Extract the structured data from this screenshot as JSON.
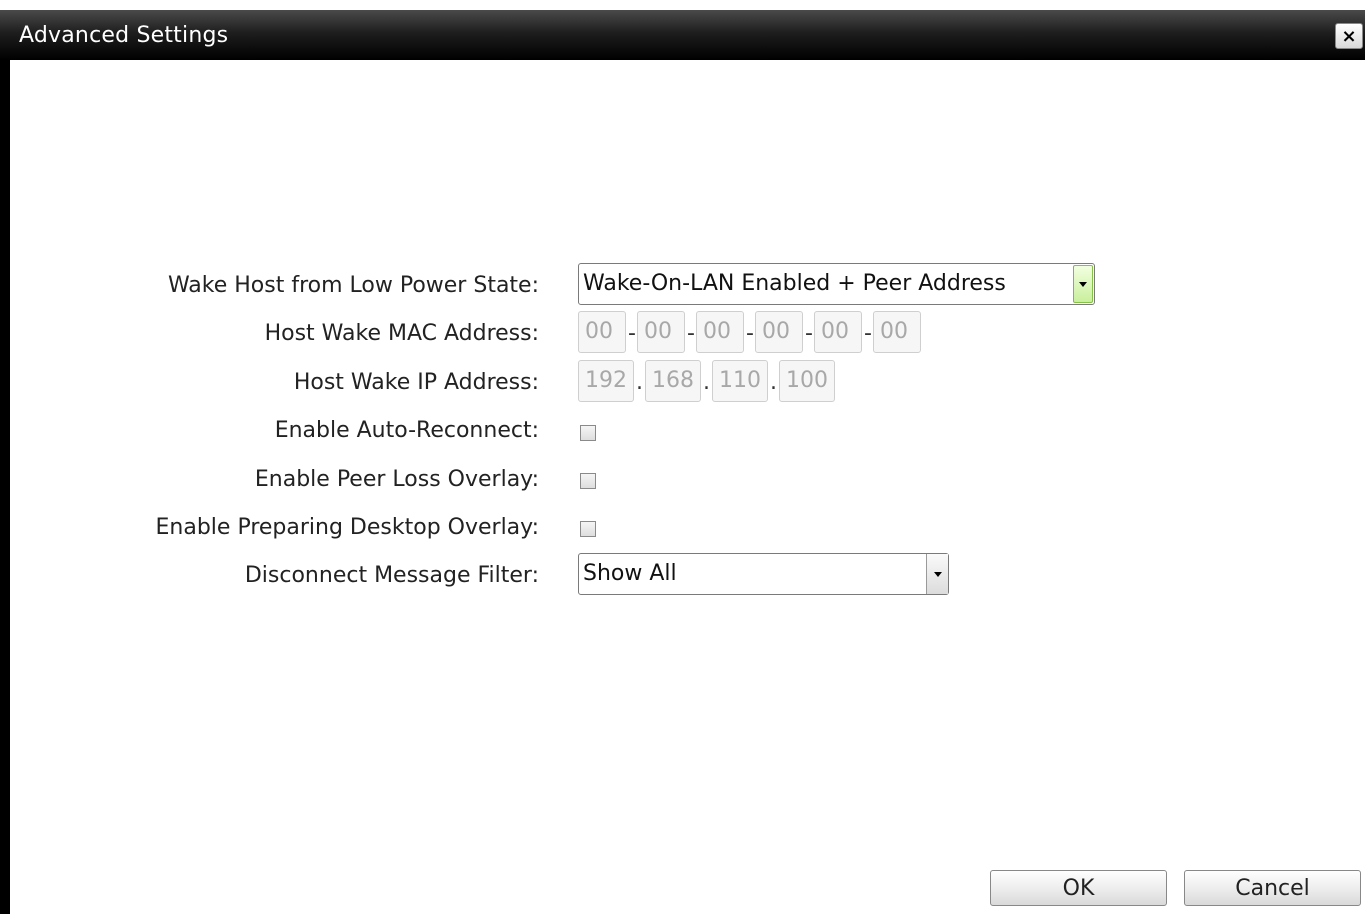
{
  "window": {
    "title": "Advanced Settings",
    "close_glyph": "×"
  },
  "form": {
    "wake_host": {
      "label": "Wake Host from Low Power State:",
      "value": "Wake-On-LAN Enabled + Peer Address"
    },
    "mac": {
      "label": "Host Wake MAC Address:",
      "octets": [
        "00",
        "00",
        "00",
        "00",
        "00",
        "00"
      ],
      "separator": "-"
    },
    "ip": {
      "label": "Host Wake IP Address:",
      "octets": [
        "192",
        "168",
        "110",
        "100"
      ],
      "separator": "."
    },
    "auto_reconnect": {
      "label": "Enable Auto-Reconnect:",
      "checked": false
    },
    "peer_loss": {
      "label": "Enable Peer Loss Overlay:",
      "checked": false
    },
    "preparing_desktop": {
      "label": "Enable Preparing Desktop Overlay:",
      "checked": false
    },
    "disconnect_filter": {
      "label": "Disconnect Message Filter:",
      "value": "Show All"
    }
  },
  "buttons": {
    "ok": "OK",
    "cancel": "Cancel"
  },
  "colors": {
    "titlebar": "#000000",
    "active_dropdown_arrow": "#c9ef9c",
    "disabled_field_text": "#a8a8a8"
  }
}
